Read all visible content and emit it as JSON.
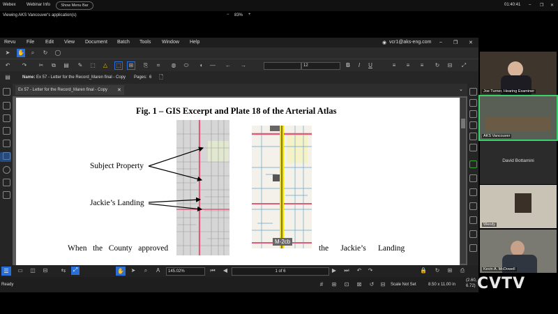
{
  "webex": {
    "app_label": "Webex",
    "webinar_info": "Webinar Info",
    "show_menu_bar": "Show Menu Bar",
    "time": "01:40:41",
    "viewing_label": "Viewing AKS Vancouver's application(s)",
    "zoom_minus": "−",
    "zoom_level": "83%",
    "zoom_plus": "+"
  },
  "revu": {
    "menu": [
      "Revu",
      "File",
      "Edit",
      "View",
      "Document",
      "Batch",
      "Tools",
      "Window",
      "Help"
    ],
    "account": "vcr1@aks-eng.com",
    "font_size_value": "12",
    "name_label": "Name:",
    "name_value": "Ex 57 - Letter for the Record_Maren final - Copy",
    "pages_label": "Pages:",
    "pages_value": "6",
    "tab_title": "Ex 57 - Letter for the Record_Maren final - Copy",
    "zoom_value": "145.02%",
    "page_nav": "1 of 6",
    "status_ready": "Ready",
    "scale": "Scale Not Set",
    "page_size": "8.50 x 11.00 in",
    "coords": [
      "(2.60,",
      "6.72)"
    ]
  },
  "document": {
    "figure_title": "Fig. 1 – GIS Excerpt and Plate 18 of the Arterial Atlas",
    "label_subject": "Subject Property",
    "label_jackies": "Jackie’s Landing",
    "map_label": "M-2cb",
    "body_left": [
      "When",
      "the",
      "County",
      "approved"
    ],
    "body_right": [
      "the",
      "Jackie’s",
      "Landing"
    ]
  },
  "participants": [
    {
      "name": "Joe Turner, Hearing Examiner"
    },
    {
      "name": "AKS Vancouver"
    },
    {
      "name": "David Bottamini"
    },
    {
      "name": "Wendy"
    },
    {
      "name": "Kevin A. McDowell"
    }
  ],
  "watermark": "CVTV",
  "colors": {
    "accent_active": "#2a6fd6",
    "road_red": "#e05a7a",
    "road_yellow": "#f2e600"
  }
}
